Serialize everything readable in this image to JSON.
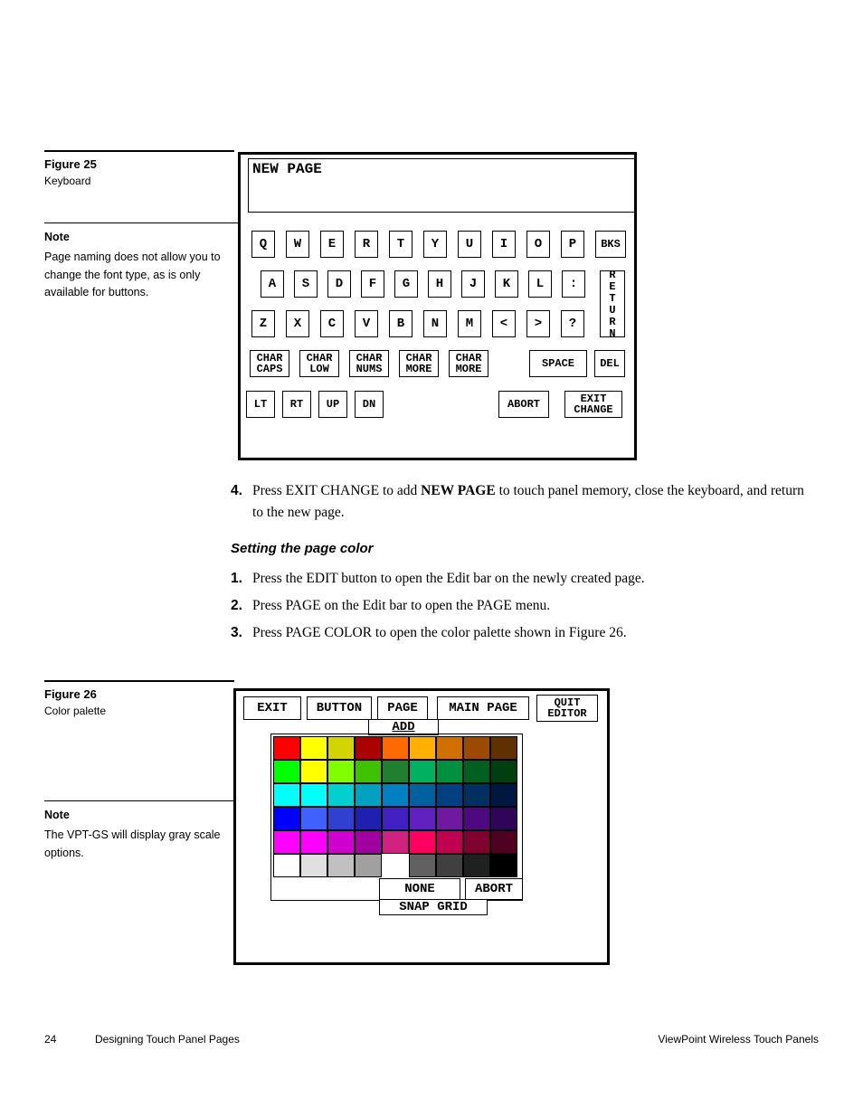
{
  "fig25": {
    "title": "Figure 25",
    "caption": "Keyboard"
  },
  "note1": {
    "title": "Note",
    "body": "Page naming does not allow you to change the font type, as is only available for buttons."
  },
  "fig26": {
    "title": "Figure 26",
    "caption": "Color palette"
  },
  "note2": {
    "title": "Note",
    "body": "The VPT-GS will display gray scale options."
  },
  "kb": {
    "input_text": "NEW PAGE",
    "row1": [
      "Q",
      "W",
      "E",
      "R",
      "T",
      "Y",
      "U",
      "I",
      "O",
      "P"
    ],
    "bks": "BKS",
    "row2": [
      "A",
      "S",
      "D",
      "F",
      "G",
      "H",
      "J",
      "K",
      "L",
      ":"
    ],
    "return": "RETURN",
    "row3": [
      "Z",
      "X",
      "C",
      "V",
      "B",
      "N",
      "M",
      "<",
      ">",
      "?"
    ],
    "fnrow": [
      "CHAR\nCAPS",
      "CHAR\nLOW",
      "CHAR\nNUMS",
      "CHAR\nMORE",
      "CHAR\nMORE"
    ],
    "space": "SPACE",
    "del": "DEL",
    "nav": [
      "LT",
      "RT",
      "UP",
      "DN"
    ],
    "abort": "ABORT",
    "exit_change": "EXIT\nCHANGE"
  },
  "body": {
    "step4_num": "4.",
    "step4_a": "Press EXIT CHANGE to add ",
    "step4_bold": "NEW PAGE",
    "step4_b": " to touch panel memory, close the keyboard, and return to the new page.",
    "subhead": "Setting the page color",
    "s1n": "1.",
    "s1": "Press the EDIT button to open the Edit bar on the newly created page.",
    "s2n": "2.",
    "s2": "Press PAGE on the Edit bar to open the PAGE menu.",
    "s3n": "3.",
    "s3": "Press PAGE COLOR to open the color palette shown in Figure 26."
  },
  "palette": {
    "top": {
      "exit": "EXIT",
      "button": "BUTTON",
      "page": "PAGE",
      "main": "MAIN PAGE",
      "quit": "QUIT\nEDITOR"
    },
    "add": "ADD",
    "none": "NONE",
    "abort": "ABORT",
    "snap": "SNAP GRID",
    "colors": [
      [
        "#ff0000",
        "#ffff00",
        "#d4d400",
        "#aa0000",
        "#ff6a00",
        "#ffb000",
        "#d07000",
        "#9c4a00",
        "#603000"
      ],
      [
        "#00ff00",
        "#ffff00",
        "#80ff00",
        "#40c000",
        "#208030",
        "#00b060",
        "#009040",
        "#006020",
        "#004010"
      ],
      [
        "#00ffff",
        "#00ffff",
        "#00d0d0",
        "#00a0c0",
        "#0080c0",
        "#0060a0",
        "#004080",
        "#003060",
        "#001840"
      ],
      [
        "#0000ff",
        "#4060ff",
        "#3040d0",
        "#2020b0",
        "#4020c0",
        "#6020c0",
        "#7018a0",
        "#500880",
        "#300458"
      ],
      [
        "#ff00ff",
        "#ff00ff",
        "#d000d0",
        "#a000a0",
        "#d02080",
        "#ff0060",
        "#c00050",
        "#800030",
        "#500020"
      ],
      [
        "#ffffff",
        "#e0e0e0",
        "#c0c0c0",
        "#a0a0a0",
        "  ",
        "#606060",
        "#404040",
        "#202020",
        "#000000"
      ]
    ]
  },
  "footer": {
    "page": "24",
    "left": "Designing Touch Panel Pages",
    "right": "ViewPoint Wireless Touch Panels"
  }
}
